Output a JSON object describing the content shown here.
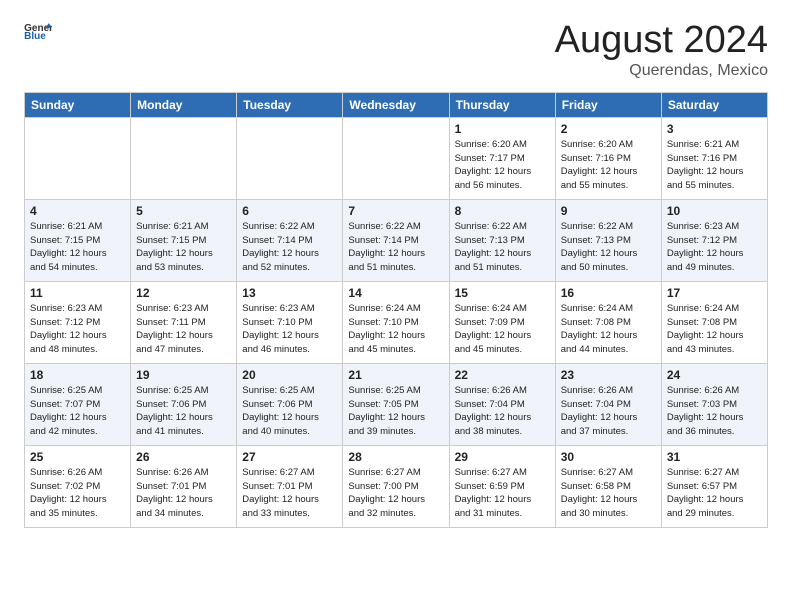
{
  "header": {
    "logo_line1": "General",
    "logo_line2": "Blue",
    "month": "August 2024",
    "location": "Querendas, Mexico"
  },
  "days_of_week": [
    "Sunday",
    "Monday",
    "Tuesday",
    "Wednesday",
    "Thursday",
    "Friday",
    "Saturday"
  ],
  "weeks": [
    [
      {
        "day": "",
        "info": ""
      },
      {
        "day": "",
        "info": ""
      },
      {
        "day": "",
        "info": ""
      },
      {
        "day": "",
        "info": ""
      },
      {
        "day": "1",
        "info": "Sunrise: 6:20 AM\nSunset: 7:17 PM\nDaylight: 12 hours\nand 56 minutes."
      },
      {
        "day": "2",
        "info": "Sunrise: 6:20 AM\nSunset: 7:16 PM\nDaylight: 12 hours\nand 55 minutes."
      },
      {
        "day": "3",
        "info": "Sunrise: 6:21 AM\nSunset: 7:16 PM\nDaylight: 12 hours\nand 55 minutes."
      }
    ],
    [
      {
        "day": "4",
        "info": "Sunrise: 6:21 AM\nSunset: 7:15 PM\nDaylight: 12 hours\nand 54 minutes."
      },
      {
        "day": "5",
        "info": "Sunrise: 6:21 AM\nSunset: 7:15 PM\nDaylight: 12 hours\nand 53 minutes."
      },
      {
        "day": "6",
        "info": "Sunrise: 6:22 AM\nSunset: 7:14 PM\nDaylight: 12 hours\nand 52 minutes."
      },
      {
        "day": "7",
        "info": "Sunrise: 6:22 AM\nSunset: 7:14 PM\nDaylight: 12 hours\nand 51 minutes."
      },
      {
        "day": "8",
        "info": "Sunrise: 6:22 AM\nSunset: 7:13 PM\nDaylight: 12 hours\nand 51 minutes."
      },
      {
        "day": "9",
        "info": "Sunrise: 6:22 AM\nSunset: 7:13 PM\nDaylight: 12 hours\nand 50 minutes."
      },
      {
        "day": "10",
        "info": "Sunrise: 6:23 AM\nSunset: 7:12 PM\nDaylight: 12 hours\nand 49 minutes."
      }
    ],
    [
      {
        "day": "11",
        "info": "Sunrise: 6:23 AM\nSunset: 7:12 PM\nDaylight: 12 hours\nand 48 minutes."
      },
      {
        "day": "12",
        "info": "Sunrise: 6:23 AM\nSunset: 7:11 PM\nDaylight: 12 hours\nand 47 minutes."
      },
      {
        "day": "13",
        "info": "Sunrise: 6:23 AM\nSunset: 7:10 PM\nDaylight: 12 hours\nand 46 minutes."
      },
      {
        "day": "14",
        "info": "Sunrise: 6:24 AM\nSunset: 7:10 PM\nDaylight: 12 hours\nand 45 minutes."
      },
      {
        "day": "15",
        "info": "Sunrise: 6:24 AM\nSunset: 7:09 PM\nDaylight: 12 hours\nand 45 minutes."
      },
      {
        "day": "16",
        "info": "Sunrise: 6:24 AM\nSunset: 7:08 PM\nDaylight: 12 hours\nand 44 minutes."
      },
      {
        "day": "17",
        "info": "Sunrise: 6:24 AM\nSunset: 7:08 PM\nDaylight: 12 hours\nand 43 minutes."
      }
    ],
    [
      {
        "day": "18",
        "info": "Sunrise: 6:25 AM\nSunset: 7:07 PM\nDaylight: 12 hours\nand 42 minutes."
      },
      {
        "day": "19",
        "info": "Sunrise: 6:25 AM\nSunset: 7:06 PM\nDaylight: 12 hours\nand 41 minutes."
      },
      {
        "day": "20",
        "info": "Sunrise: 6:25 AM\nSunset: 7:06 PM\nDaylight: 12 hours\nand 40 minutes."
      },
      {
        "day": "21",
        "info": "Sunrise: 6:25 AM\nSunset: 7:05 PM\nDaylight: 12 hours\nand 39 minutes."
      },
      {
        "day": "22",
        "info": "Sunrise: 6:26 AM\nSunset: 7:04 PM\nDaylight: 12 hours\nand 38 minutes."
      },
      {
        "day": "23",
        "info": "Sunrise: 6:26 AM\nSunset: 7:04 PM\nDaylight: 12 hours\nand 37 minutes."
      },
      {
        "day": "24",
        "info": "Sunrise: 6:26 AM\nSunset: 7:03 PM\nDaylight: 12 hours\nand 36 minutes."
      }
    ],
    [
      {
        "day": "25",
        "info": "Sunrise: 6:26 AM\nSunset: 7:02 PM\nDaylight: 12 hours\nand 35 minutes."
      },
      {
        "day": "26",
        "info": "Sunrise: 6:26 AM\nSunset: 7:01 PM\nDaylight: 12 hours\nand 34 minutes."
      },
      {
        "day": "27",
        "info": "Sunrise: 6:27 AM\nSunset: 7:01 PM\nDaylight: 12 hours\nand 33 minutes."
      },
      {
        "day": "28",
        "info": "Sunrise: 6:27 AM\nSunset: 7:00 PM\nDaylight: 12 hours\nand 32 minutes."
      },
      {
        "day": "29",
        "info": "Sunrise: 6:27 AM\nSunset: 6:59 PM\nDaylight: 12 hours\nand 31 minutes."
      },
      {
        "day": "30",
        "info": "Sunrise: 6:27 AM\nSunset: 6:58 PM\nDaylight: 12 hours\nand 30 minutes."
      },
      {
        "day": "31",
        "info": "Sunrise: 6:27 AM\nSunset: 6:57 PM\nDaylight: 12 hours\nand 29 minutes."
      }
    ]
  ]
}
